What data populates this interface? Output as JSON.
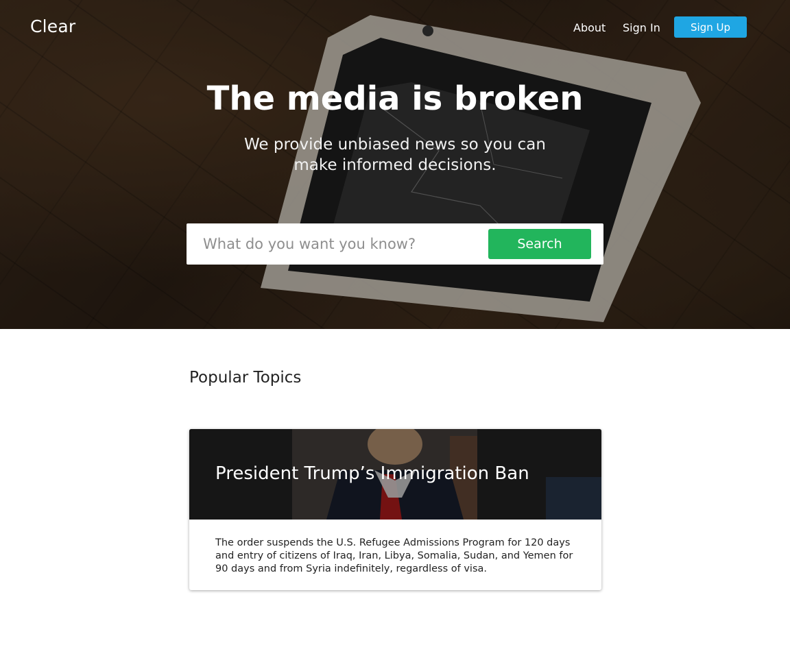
{
  "header": {
    "logo": "Clear",
    "nav": {
      "about": "About",
      "sign_in": "Sign In",
      "sign_up": "Sign Up"
    }
  },
  "hero": {
    "headline": "The media is broken",
    "subline": "We provide unbiased news so you can make informed decisions.",
    "search": {
      "placeholder": "What do you want you know?",
      "button": "Search"
    }
  },
  "main": {
    "section_title": "Popular Topics",
    "topics": [
      {
        "title": "President Trump’s Immigration Ban",
        "summary": "The order suspends the U.S. Refugee Admissions Program for 120 days and entry of citizens of Iraq, Iran, Libya, Somalia, Sudan, and Yemen for 90 days and from Syria indefinitely, regardless of visa."
      }
    ]
  },
  "colors": {
    "sign_up": "#1fa6e3",
    "search": "#22b55c"
  }
}
